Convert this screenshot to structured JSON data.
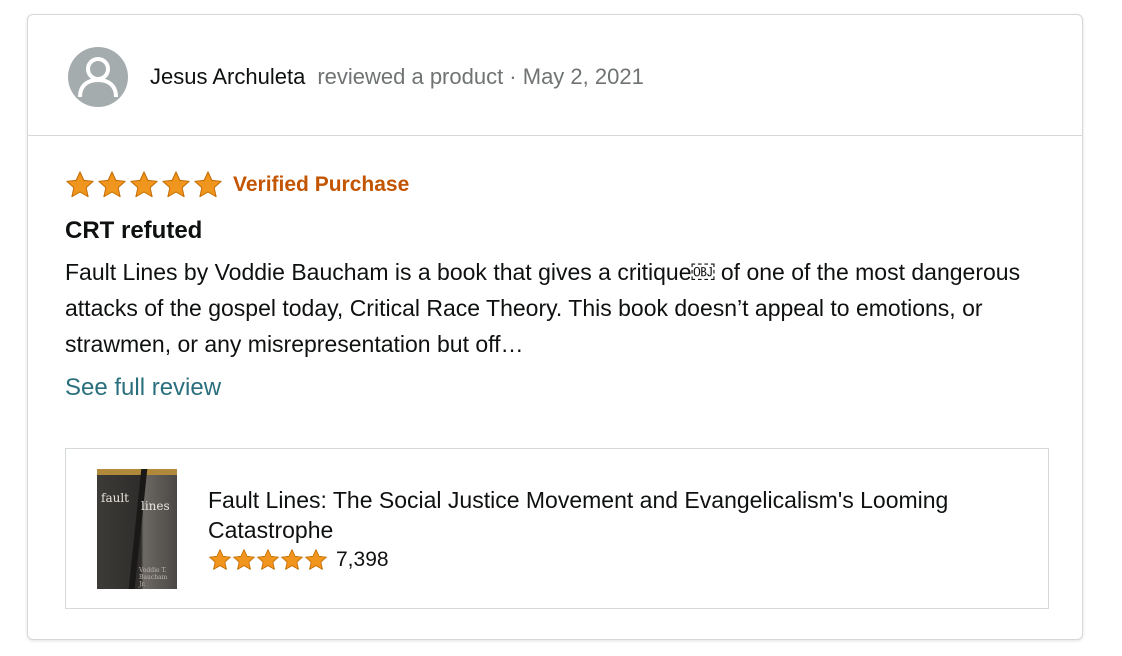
{
  "reviewer": {
    "name": "Jesus Archuleta",
    "meta": "reviewed a product · May 2, 2021"
  },
  "review": {
    "rating": 5,
    "verified_label": "Verified Purchase",
    "title": "CRT refuted",
    "text": "Fault Lines by Voddie Baucham is a book that gives a critique￼ of one of the most dangerous attacks of the gospel today, Critical Race Theory. This book doesn’t appeal to emotions, or strawmen, or any misrepresentation but off…",
    "see_full_label": "See full review"
  },
  "product": {
    "title": "Fault Lines: The Social Justice Movement and Evangelicalism's Looming Catastrophe",
    "rating": 5,
    "rating_count": "7,398",
    "cover_text_left": "fault",
    "cover_text_right": "lines",
    "cover_author": "Voddie T. Baucham Jr."
  },
  "colors": {
    "star": "#f0961e",
    "verified": "#c45500",
    "link": "#2a6f7d",
    "avatar": "#a4acad"
  },
  "icons": {
    "avatar": "user-avatar-icon",
    "star": "star-icon"
  }
}
